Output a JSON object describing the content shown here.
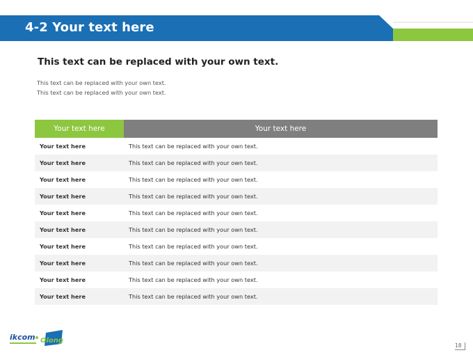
{
  "slide": {
    "title": "4-2 Your text here",
    "subtitle": "This text can be replaced with your own text.",
    "body_lines": [
      "This text can be replaced with your own text.",
      "This text can be replaced with your own text."
    ],
    "page_number": "18",
    "colors": {
      "title_blue": "#1a6fb5",
      "accent_green": "#8dc63f",
      "header_gray": "#7f7f7f",
      "row_stripe": "#f2f2f2"
    }
  },
  "table": {
    "headers": [
      "Your text here",
      "Your text here"
    ],
    "rows": [
      [
        "Your text here",
        "This text can be replaced with your own text."
      ],
      [
        "Your text here",
        "This text can be replaced with your own text."
      ],
      [
        "Your text here",
        "This text can be replaced with your own text."
      ],
      [
        "Your text here",
        "This text can be replaced with your own text."
      ],
      [
        "Your text here",
        "This text can be replaced with your own text."
      ],
      [
        "Your text here",
        "This text can be replaced with your own text."
      ],
      [
        "Your text here",
        "This text can be replaced with your own text."
      ],
      [
        "Your text here",
        "This text can be replaced with your own text."
      ],
      [
        "Your text here",
        "This text can be replaced with your own text."
      ],
      [
        "Your text here",
        "This text can be replaced with your own text."
      ]
    ]
  },
  "logo": {
    "icon": "company-logo",
    "text": "ikcom Olong"
  }
}
